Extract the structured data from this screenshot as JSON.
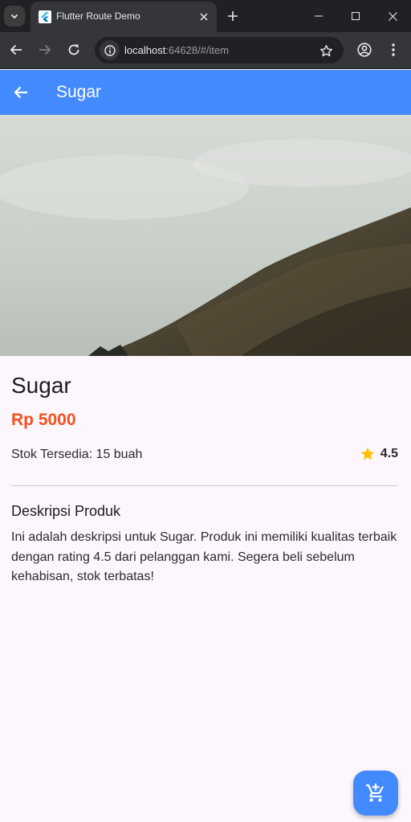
{
  "browser": {
    "tab_title": "Flutter Route Demo",
    "url_host": "localhost",
    "url_path": ":64628/#/item"
  },
  "appbar": {
    "title": "Sugar"
  },
  "product": {
    "name": "Sugar",
    "price": "Rp 5000",
    "stock": "Stok Tersedia: 15 buah",
    "rating": "4.5",
    "description_title": "Deskripsi Produk",
    "description": "Ini adalah deskripsi untuk Sugar. Produk ini memiliki kualitas terbaik dengan rating 4.5 dari pelanggan kami. Segera beli sebelum kehabisan, stok terbatas!"
  },
  "icons": {
    "back": "arrow-back-icon",
    "rating": "star-icon",
    "fab": "add-shopping-cart-icon"
  },
  "colors": {
    "appbar": "#448aff",
    "price": "#f4511e",
    "star": "#ffc107",
    "background": "#fdf7fd"
  }
}
